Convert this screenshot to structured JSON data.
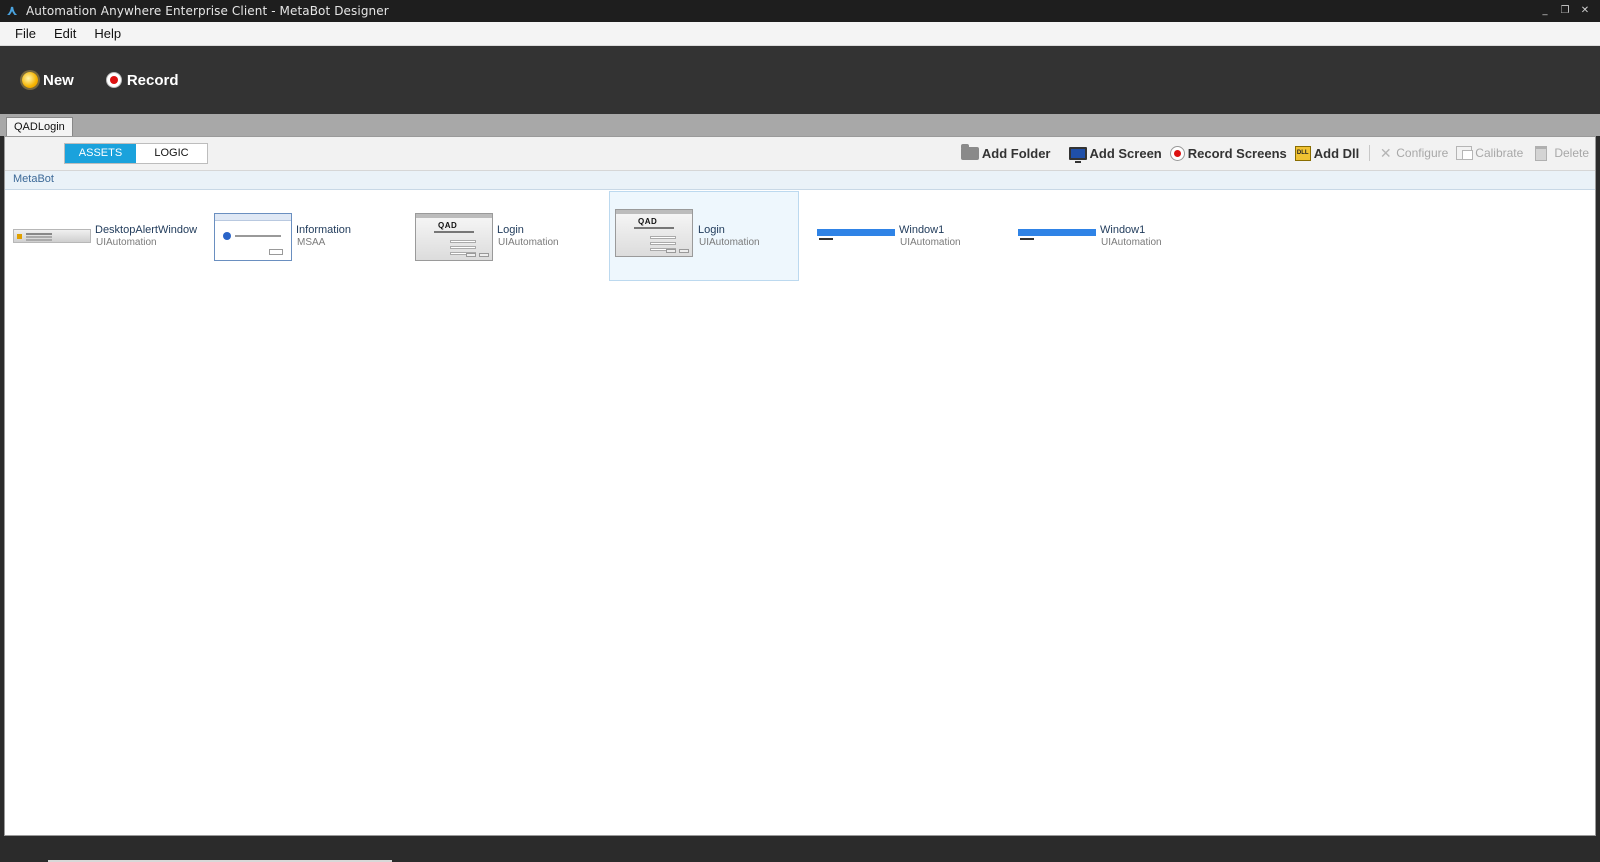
{
  "window": {
    "title": "Automation Anywhere Enterprise Client - MetaBot Designer",
    "controls": [
      "_",
      "❐",
      "✕"
    ]
  },
  "menu": [
    "File",
    "Edit",
    "Help"
  ],
  "toolbar": {
    "new_label": "New",
    "record_label": "Record"
  },
  "doc_tab": "QADLogin",
  "view_toggle": {
    "assets": "ASSETS",
    "logic": "LOGIC",
    "active": "assets"
  },
  "actions": {
    "add_folder": "Add Folder",
    "add_screen": "Add Screen",
    "record_screens": "Record Screens",
    "add_dll": "Add Dll",
    "configure": "Configure",
    "calibrate": "Calibrate",
    "delete": "Delete"
  },
  "breadcrumb": "MetaBot",
  "assets": [
    {
      "name": "DesktopAlertWindow",
      "kind": "UIAutomation",
      "thumb": "alert"
    },
    {
      "name": "Information",
      "kind": "MSAA",
      "thumb": "info"
    },
    {
      "name": "Login",
      "kind": "UIAutomation",
      "thumb": "login"
    },
    {
      "name": "Login",
      "kind": "UIAutomation",
      "thumb": "login",
      "selected": true
    },
    {
      "name": "Window1",
      "kind": "UIAutomation",
      "thumb": "window"
    },
    {
      "name": "Window1",
      "kind": "UIAutomation",
      "thumb": "window"
    }
  ],
  "thumb_text": {
    "qad_logo": "QAD"
  },
  "colors": {
    "accent": "#1aa2dc",
    "toolbar_bg": "#333333",
    "selected_bg": "#eef7fd"
  }
}
